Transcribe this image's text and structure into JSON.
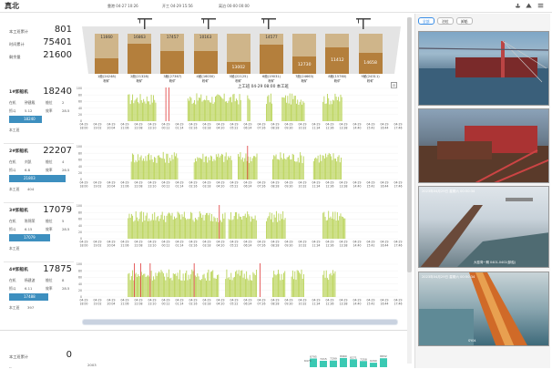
{
  "app": {
    "title": "真北"
  },
  "header": {
    "arrival": "靠港 04-27 10:26",
    "work_start": "开工 04-29 15:56",
    "departure": "离泊 00-00 00:00"
  },
  "holds": [
    {
      "top_value": "11660",
      "bottom_value": "",
      "label": "1舱(24248)",
      "sub": "粉矿",
      "ratio": 0.48
    },
    {
      "top_value": "16863",
      "bottom_value": "",
      "label": "2舱(21328)",
      "sub": "粉矿",
      "ratio": 0.79
    },
    {
      "top_value": "17457",
      "bottom_value": "",
      "label": "3舱(27367)",
      "sub": "粉矿",
      "ratio": 0.64
    },
    {
      "top_value": "10163",
      "bottom_value": "",
      "label": "4舱(16030)",
      "sub": "粉矿",
      "ratio": 0.63
    },
    {
      "top_value": "",
      "bottom_value": "13002",
      "label": "5舱(22125)",
      "sub": "粉矿",
      "ratio": 0.41
    },
    {
      "top_value": "14577",
      "bottom_value": "",
      "label": "6舱(19031)",
      "sub": "粉矿",
      "ratio": 0.77
    },
    {
      "top_value": "",
      "bottom_value": "12730",
      "label": "7舱(24663)",
      "sub": "粉矿",
      "ratio": 0.52
    },
    {
      "top_value": "",
      "bottom_value": "11412",
      "label": "8舱(15760)",
      "sub": "粉矿",
      "ratio": 0.72
    },
    {
      "top_value": "",
      "bottom_value": "14658",
      "label": "9舱(24311)",
      "sub": "粉矿",
      "ratio": 0.6
    }
  ],
  "summary": [
    {
      "label": "本工班累计",
      "value": "801"
    },
    {
      "label": "时间累计",
      "value": "75401"
    },
    {
      "label": "剩余量",
      "value": "21600"
    }
  ],
  "chart_header": "上工班 04-29 08:00 本工班",
  "unloaders": [
    {
      "name": "1#卸船机",
      "total": "18240",
      "info1": "在机",
      "info1b": "钟建殿",
      "info1c": "舱位",
      "info1d": "2",
      "info2": "抓斗",
      "info2b": "5.12",
      "info2c": "效率",
      "info2d": "28.5",
      "prev_label": "上工班",
      "prev_value": "18240",
      "prev_ratio": 0.4,
      "cur_label": "本工班",
      "cur_value": ""
    },
    {
      "name": "2#卸船机",
      "total": "22207",
      "info1": "在机",
      "info1b": "刘凯",
      "info1c": "舱位",
      "info1d": "4",
      "info2": "抓斗",
      "info2b": "6.8",
      "info2c": "效率",
      "info2d": "26.5",
      "prev_label": "上工班",
      "prev_value": "21803",
      "prev_ratio": 0.85,
      "cur_label": "本工班",
      "cur_value": "404"
    },
    {
      "name": "3#卸船机",
      "total": "17079",
      "info1": "在机",
      "info1b": "陈锦荣",
      "info1c": "舱位",
      "info1d": "5",
      "info2": "抓斗",
      "info2b": "6.15",
      "info2c": "效率",
      "info2d": "28.5",
      "prev_label": "上工班",
      "prev_value": "17079",
      "prev_ratio": 0.55,
      "cur_label": "本工班",
      "cur_value": ""
    },
    {
      "name": "4#卸船机",
      "total": "17875",
      "info1": "在机",
      "info1b": "杨建波",
      "info1c": "舱位",
      "info1d": "8",
      "info2": "抓斗",
      "info2b": "6.11",
      "info2c": "效率",
      "info2d": "28.5",
      "prev_label": "上工班",
      "prev_value": "17488",
      "prev_ratio": 0.52,
      "cur_label": "本工班",
      "cur_value": "397"
    }
  ],
  "y_ticks": [
    "100",
    "80",
    "60",
    "40",
    "20",
    "0"
  ],
  "x_ticks": [
    {
      "d": "04-29",
      "t": "18:00"
    },
    {
      "d": "04-29",
      "t": "19:02"
    },
    {
      "d": "04-29",
      "t": "20:04"
    },
    {
      "d": "04-29",
      "t": "21:06"
    },
    {
      "d": "04-29",
      "t": "22:08"
    },
    {
      "d": "04-29",
      "t": "23:10"
    },
    {
      "d": "04-29",
      "t": "00:12"
    },
    {
      "d": "04-29",
      "t": "01:14"
    },
    {
      "d": "04-29",
      "t": "02:16"
    },
    {
      "d": "04-29",
      "t": "03:18"
    },
    {
      "d": "04-29",
      "t": "04:20"
    },
    {
      "d": "04-29",
      "t": "05:22"
    },
    {
      "d": "04-29",
      "t": "06:24"
    },
    {
      "d": "04-29",
      "t": "07:26"
    },
    {
      "d": "04-29",
      "t": "08:28"
    },
    {
      "d": "04-29",
      "t": "09:30"
    },
    {
      "d": "04-29",
      "t": "10:32"
    },
    {
      "d": "04-29",
      "t": "11:34"
    },
    {
      "d": "04-29",
      "t": "12:36"
    },
    {
      "d": "04-29",
      "t": "13:38"
    },
    {
      "d": "04-29",
      "t": "14:40"
    },
    {
      "d": "04-29",
      "t": "15:42"
    },
    {
      "d": "04-29",
      "t": "16:44"
    },
    {
      "d": "04-29",
      "t": "17:46"
    }
  ],
  "bottom": {
    "label1": "本工班累计",
    "value1": "0",
    "label2": "--",
    "value2": "",
    "label3": "--",
    "value3": "",
    "small_axis": "2003",
    "bars": [
      {
        "v": "8795",
        "ratio": 0.68
      },
      {
        "v": "7215",
        "ratio": 0.5
      },
      {
        "v": "7299",
        "ratio": 0.52
      },
      {
        "v": "8960",
        "ratio": 0.72
      },
      {
        "v": "8271",
        "ratio": 0.62
      },
      {
        "v": "7258",
        "ratio": 0.48
      },
      {
        "v": "6290",
        "ratio": 0.35
      },
      {
        "v": "8832",
        "ratio": 0.7
      }
    ],
    "first_bar_label": "6470"
  },
  "cameras": {
    "tabs": [
      "全部",
      "泊位",
      "卸船"
    ],
    "feeds": [
      {
        "timestamp": "",
        "caption": ""
      },
      {
        "timestamp": "",
        "caption": ""
      },
      {
        "timestamp": "2023年04月29日 星期六 00:50:34",
        "caption": "大窑湾一期 0401-0402(卸船)"
      },
      {
        "timestamp": "2023年04月29日 星期六 00:50:34",
        "caption": "SY04"
      }
    ]
  },
  "colors": {
    "accent": "#3a8ee6",
    "bar_green": "#b9d357",
    "peak_red": "#e03a3a",
    "hold_top": "#cfb58a",
    "hold_bottom": "#b47f3c",
    "blue_bar": "#3d8fbf"
  }
}
